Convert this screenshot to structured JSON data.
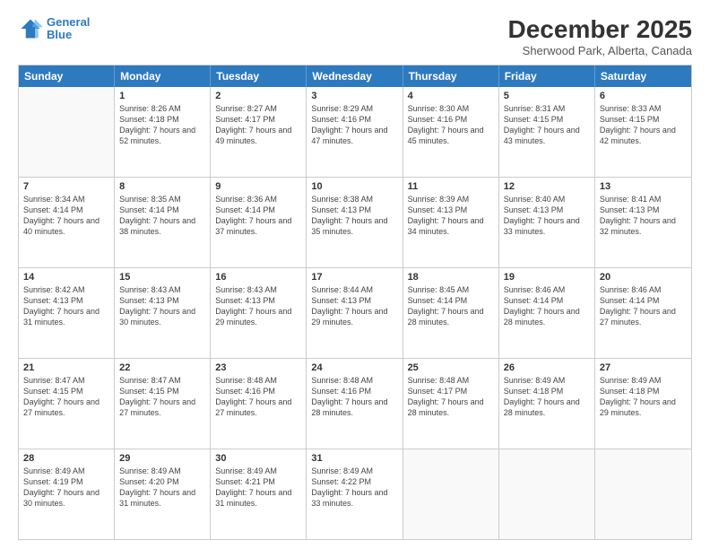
{
  "logo": {
    "line1": "General",
    "line2": "Blue"
  },
  "title": "December 2025",
  "subtitle": "Sherwood Park, Alberta, Canada",
  "days_of_week": [
    "Sunday",
    "Monday",
    "Tuesday",
    "Wednesday",
    "Thursday",
    "Friday",
    "Saturday"
  ],
  "weeks": [
    [
      {
        "day": "",
        "sunrise": "",
        "sunset": "",
        "daylight": ""
      },
      {
        "day": "1",
        "sunrise": "Sunrise: 8:26 AM",
        "sunset": "Sunset: 4:18 PM",
        "daylight": "Daylight: 7 hours and 52 minutes."
      },
      {
        "day": "2",
        "sunrise": "Sunrise: 8:27 AM",
        "sunset": "Sunset: 4:17 PM",
        "daylight": "Daylight: 7 hours and 49 minutes."
      },
      {
        "day": "3",
        "sunrise": "Sunrise: 8:29 AM",
        "sunset": "Sunset: 4:16 PM",
        "daylight": "Daylight: 7 hours and 47 minutes."
      },
      {
        "day": "4",
        "sunrise": "Sunrise: 8:30 AM",
        "sunset": "Sunset: 4:16 PM",
        "daylight": "Daylight: 7 hours and 45 minutes."
      },
      {
        "day": "5",
        "sunrise": "Sunrise: 8:31 AM",
        "sunset": "Sunset: 4:15 PM",
        "daylight": "Daylight: 7 hours and 43 minutes."
      },
      {
        "day": "6",
        "sunrise": "Sunrise: 8:33 AM",
        "sunset": "Sunset: 4:15 PM",
        "daylight": "Daylight: 7 hours and 42 minutes."
      }
    ],
    [
      {
        "day": "7",
        "sunrise": "Sunrise: 8:34 AM",
        "sunset": "Sunset: 4:14 PM",
        "daylight": "Daylight: 7 hours and 40 minutes."
      },
      {
        "day": "8",
        "sunrise": "Sunrise: 8:35 AM",
        "sunset": "Sunset: 4:14 PM",
        "daylight": "Daylight: 7 hours and 38 minutes."
      },
      {
        "day": "9",
        "sunrise": "Sunrise: 8:36 AM",
        "sunset": "Sunset: 4:14 PM",
        "daylight": "Daylight: 7 hours and 37 minutes."
      },
      {
        "day": "10",
        "sunrise": "Sunrise: 8:38 AM",
        "sunset": "Sunset: 4:13 PM",
        "daylight": "Daylight: 7 hours and 35 minutes."
      },
      {
        "day": "11",
        "sunrise": "Sunrise: 8:39 AM",
        "sunset": "Sunset: 4:13 PM",
        "daylight": "Daylight: 7 hours and 34 minutes."
      },
      {
        "day": "12",
        "sunrise": "Sunrise: 8:40 AM",
        "sunset": "Sunset: 4:13 PM",
        "daylight": "Daylight: 7 hours and 33 minutes."
      },
      {
        "day": "13",
        "sunrise": "Sunrise: 8:41 AM",
        "sunset": "Sunset: 4:13 PM",
        "daylight": "Daylight: 7 hours and 32 minutes."
      }
    ],
    [
      {
        "day": "14",
        "sunrise": "Sunrise: 8:42 AM",
        "sunset": "Sunset: 4:13 PM",
        "daylight": "Daylight: 7 hours and 31 minutes."
      },
      {
        "day": "15",
        "sunrise": "Sunrise: 8:43 AM",
        "sunset": "Sunset: 4:13 PM",
        "daylight": "Daylight: 7 hours and 30 minutes."
      },
      {
        "day": "16",
        "sunrise": "Sunrise: 8:43 AM",
        "sunset": "Sunset: 4:13 PM",
        "daylight": "Daylight: 7 hours and 29 minutes."
      },
      {
        "day": "17",
        "sunrise": "Sunrise: 8:44 AM",
        "sunset": "Sunset: 4:13 PM",
        "daylight": "Daylight: 7 hours and 29 minutes."
      },
      {
        "day": "18",
        "sunrise": "Sunrise: 8:45 AM",
        "sunset": "Sunset: 4:14 PM",
        "daylight": "Daylight: 7 hours and 28 minutes."
      },
      {
        "day": "19",
        "sunrise": "Sunrise: 8:46 AM",
        "sunset": "Sunset: 4:14 PM",
        "daylight": "Daylight: 7 hours and 28 minutes."
      },
      {
        "day": "20",
        "sunrise": "Sunrise: 8:46 AM",
        "sunset": "Sunset: 4:14 PM",
        "daylight": "Daylight: 7 hours and 27 minutes."
      }
    ],
    [
      {
        "day": "21",
        "sunrise": "Sunrise: 8:47 AM",
        "sunset": "Sunset: 4:15 PM",
        "daylight": "Daylight: 7 hours and 27 minutes."
      },
      {
        "day": "22",
        "sunrise": "Sunrise: 8:47 AM",
        "sunset": "Sunset: 4:15 PM",
        "daylight": "Daylight: 7 hours and 27 minutes."
      },
      {
        "day": "23",
        "sunrise": "Sunrise: 8:48 AM",
        "sunset": "Sunset: 4:16 PM",
        "daylight": "Daylight: 7 hours and 27 minutes."
      },
      {
        "day": "24",
        "sunrise": "Sunrise: 8:48 AM",
        "sunset": "Sunset: 4:16 PM",
        "daylight": "Daylight: 7 hours and 28 minutes."
      },
      {
        "day": "25",
        "sunrise": "Sunrise: 8:48 AM",
        "sunset": "Sunset: 4:17 PM",
        "daylight": "Daylight: 7 hours and 28 minutes."
      },
      {
        "day": "26",
        "sunrise": "Sunrise: 8:49 AM",
        "sunset": "Sunset: 4:18 PM",
        "daylight": "Daylight: 7 hours and 28 minutes."
      },
      {
        "day": "27",
        "sunrise": "Sunrise: 8:49 AM",
        "sunset": "Sunset: 4:18 PM",
        "daylight": "Daylight: 7 hours and 29 minutes."
      }
    ],
    [
      {
        "day": "28",
        "sunrise": "Sunrise: 8:49 AM",
        "sunset": "Sunset: 4:19 PM",
        "daylight": "Daylight: 7 hours and 30 minutes."
      },
      {
        "day": "29",
        "sunrise": "Sunrise: 8:49 AM",
        "sunset": "Sunset: 4:20 PM",
        "daylight": "Daylight: 7 hours and 31 minutes."
      },
      {
        "day": "30",
        "sunrise": "Sunrise: 8:49 AM",
        "sunset": "Sunset: 4:21 PM",
        "daylight": "Daylight: 7 hours and 31 minutes."
      },
      {
        "day": "31",
        "sunrise": "Sunrise: 8:49 AM",
        "sunset": "Sunset: 4:22 PM",
        "daylight": "Daylight: 7 hours and 33 minutes."
      },
      {
        "day": "",
        "sunrise": "",
        "sunset": "",
        "daylight": ""
      },
      {
        "day": "",
        "sunrise": "",
        "sunset": "",
        "daylight": ""
      },
      {
        "day": "",
        "sunrise": "",
        "sunset": "",
        "daylight": ""
      }
    ]
  ]
}
